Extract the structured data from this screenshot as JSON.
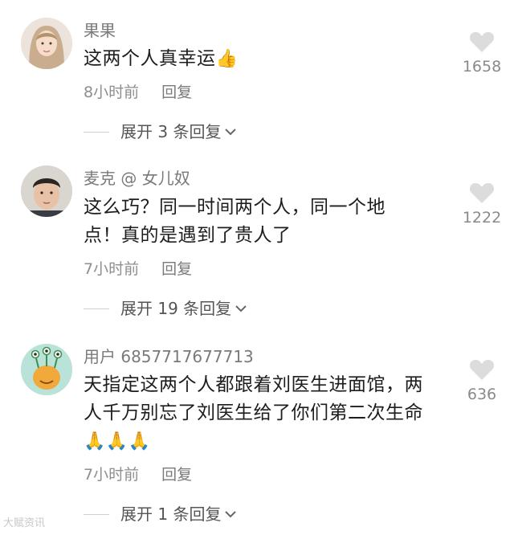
{
  "comments": [
    {
      "username": "果果",
      "text": "这两个人真幸运",
      "emoji": "👍",
      "time": "8小时前",
      "reply_label": "回复",
      "likes": "1658",
      "expand_label": "展开 3 条回复"
    },
    {
      "username": "麦克 @ 女儿奴",
      "text": "这么巧？同一时间两个人，同一个地点！真的是遇到了贵人了",
      "emoji": "",
      "time": "7小时前",
      "reply_label": "回复",
      "likes": "1222",
      "expand_label": "展开 19 条回复"
    },
    {
      "username": "用户 6857717677713",
      "text": "天指定这两个人都跟着刘医生进面馆，两人千万别忘了刘医生给了你们第二次生命",
      "emoji": "🙏🙏🙏",
      "time": "7小时前",
      "reply_label": "回复",
      "likes": "636",
      "expand_label": "展开 1 条回复"
    }
  ],
  "icons": {
    "like": "heart-icon",
    "expand": "chevron-down-icon"
  },
  "colors": {
    "username": "#7a7a7a",
    "content": "#1d1d1d",
    "meta": "#8e8e8e",
    "heart": "#dcdcdc"
  },
  "watermark": "大赋资讯"
}
